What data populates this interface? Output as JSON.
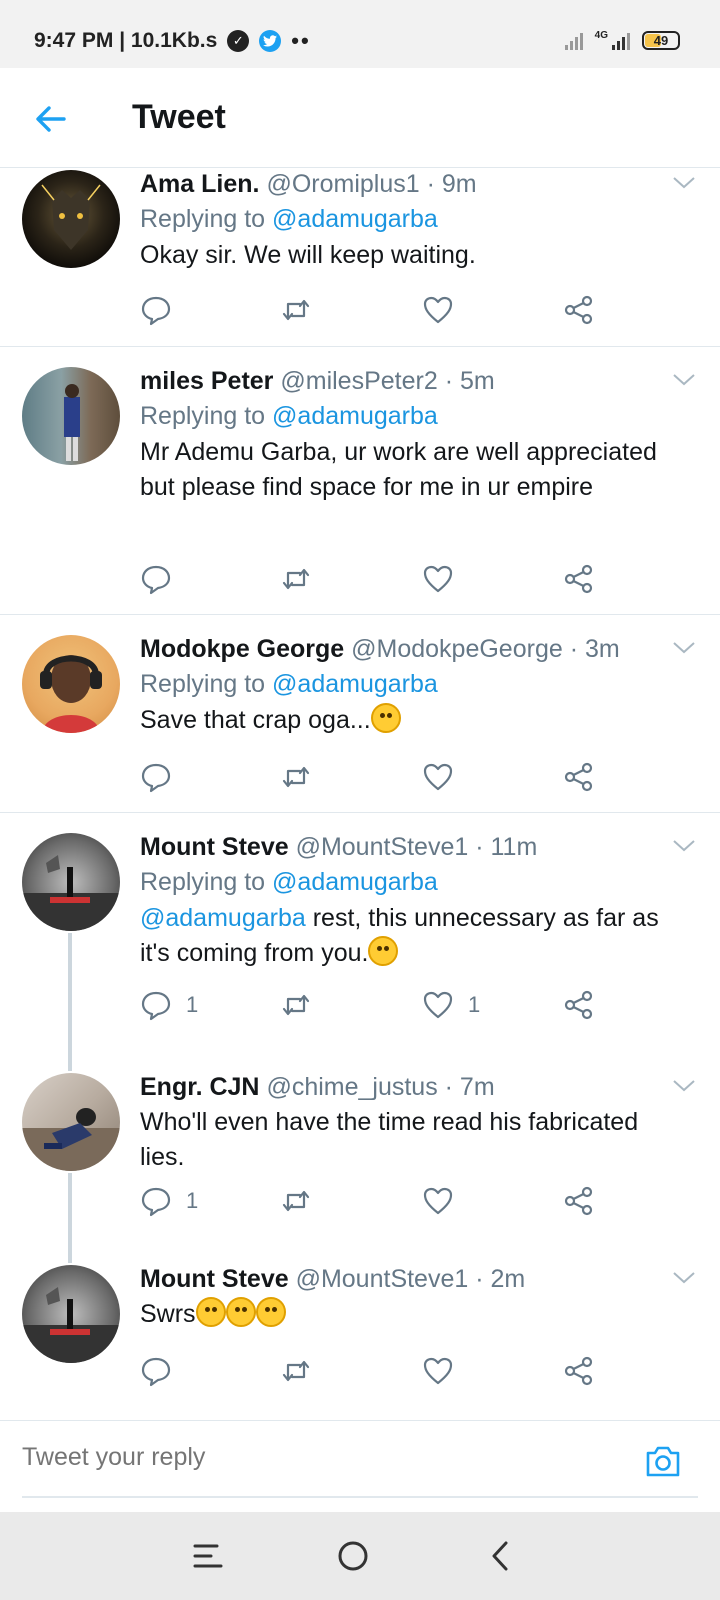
{
  "status_bar": {
    "time_speed": "9:47 PM | 10.1Kb.s",
    "dots": "••",
    "network": "4G",
    "battery": "49"
  },
  "header": {
    "title": "Tweet"
  },
  "tweets": [
    {
      "name": "Ama Lien.",
      "handle": "@Oromiplus1 · 9m",
      "replying_prefix": "Replying to",
      "replying_handle": "@adamugarba",
      "text": "Okay sir. We will keep waiting.",
      "replies": "",
      "likes": ""
    },
    {
      "name": "miles Peter",
      "handle": "@milesPeter2 · 5m",
      "replying_prefix": "Replying to",
      "replying_handle": "@adamugarba",
      "text": "Mr Ademu Garba, ur work are well appreciated but please find space for me in ur empire",
      "replies": "",
      "likes": ""
    },
    {
      "name": "Modokpe George",
      "handle": "@ModokpeGeorge · 3m",
      "replying_prefix": "Replying to",
      "replying_handle": "@adamugarba",
      "text": "Save that crap oga...",
      "replies": "",
      "likes": ""
    },
    {
      "name": "Mount Steve",
      "handle": "@MountSteve1 · 11m",
      "replying_prefix": "Replying to",
      "replying_handle": "@adamugarba",
      "text_mention": "@adamugarba",
      "text": " rest, this unnecessary as far as it's coming from you.",
      "replies": "1",
      "likes": "1"
    },
    {
      "name": "Engr. CJN",
      "handle": "@chime_justus · 7m",
      "text": "Who'll even have the time read his fabricated lies.",
      "replies": "1",
      "likes": ""
    },
    {
      "name": "Mount Steve",
      "handle": "@MountSteve1 · 2m",
      "text": "Swrs",
      "replies": "",
      "likes": ""
    }
  ],
  "reply_bar": {
    "placeholder": "Tweet your reply"
  },
  "colors": {
    "accent": "#1da1f2",
    "link": "#1b95e0",
    "muted": "#657786",
    "text": "#14171a"
  },
  "icons": [
    "back-arrow-icon",
    "chevron-down-icon",
    "reply-icon",
    "retweet-icon",
    "like-icon",
    "share-icon",
    "camera-icon",
    "menu-icon",
    "home-circle-icon",
    "back-chevron-icon"
  ]
}
